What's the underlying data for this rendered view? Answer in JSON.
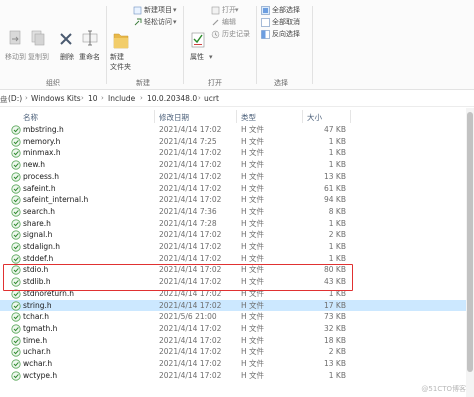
{
  "ribbon": {
    "move_to": "移动到",
    "copy_to": "复制到",
    "delete": "删除",
    "rename": "重命名",
    "organize": "组织",
    "new_item": "新建项目",
    "easy_access": "轻松访问",
    "new_folder_line1": "新建",
    "new_folder_line2": "文件夹",
    "new_group": "新建",
    "properties": "属性",
    "open": "打开",
    "edit": "编辑",
    "history": "历史记录",
    "open_group": "打开",
    "select_all": "全部选择",
    "select_none": "全部取消",
    "invert_selection": "反向选择",
    "select_group": "选择"
  },
  "address": {
    "crumbs": [
      "(D:)",
      "Windows Kits",
      "10",
      "Include",
      "10.0.20348.0",
      "ucrt"
    ],
    "lead_char": "盘"
  },
  "columns": {
    "name": "名称",
    "date": "修改日期",
    "type": "类型",
    "size": "大小"
  },
  "files": [
    {
      "name": "mbstring.h",
      "date": "2021/4/14 17:02",
      "type": "H 文件",
      "size": "47 KB"
    },
    {
      "name": "memory.h",
      "date": "2021/4/14 7:25",
      "type": "H 文件",
      "size": "1 KB"
    },
    {
      "name": "minmax.h",
      "date": "2021/4/14 17:02",
      "type": "H 文件",
      "size": "1 KB"
    },
    {
      "name": "new.h",
      "date": "2021/4/14 17:02",
      "type": "H 文件",
      "size": "1 KB"
    },
    {
      "name": "process.h",
      "date": "2021/4/14 17:02",
      "type": "H 文件",
      "size": "13 KB"
    },
    {
      "name": "safeint.h",
      "date": "2021/4/14 17:02",
      "type": "H 文件",
      "size": "61 KB"
    },
    {
      "name": "safeint_internal.h",
      "date": "2021/4/14 17:02",
      "type": "H 文件",
      "size": "94 KB"
    },
    {
      "name": "search.h",
      "date": "2021/4/14 7:36",
      "type": "H 文件",
      "size": "8 KB"
    },
    {
      "name": "share.h",
      "date": "2021/4/14 7:28",
      "type": "H 文件",
      "size": "1 KB"
    },
    {
      "name": "signal.h",
      "date": "2021/4/14 17:02",
      "type": "H 文件",
      "size": "2 KB"
    },
    {
      "name": "stdalign.h",
      "date": "2021/4/14 17:02",
      "type": "H 文件",
      "size": "1 KB"
    },
    {
      "name": "stddef.h",
      "date": "2021/4/14 17:02",
      "type": "H 文件",
      "size": "1 KB"
    },
    {
      "name": "stdio.h",
      "date": "2021/4/14 17:02",
      "type": "H 文件",
      "size": "80 KB"
    },
    {
      "name": "stdlib.h",
      "date": "2021/4/14 17:02",
      "type": "H 文件",
      "size": "43 KB"
    },
    {
      "name": "stdnoreturn.h",
      "date": "2021/4/14 17:02",
      "type": "H 文件",
      "size": "1 KB"
    },
    {
      "name": "string.h",
      "date": "2021/4/14 17:02",
      "type": "H 文件",
      "size": "17 KB"
    },
    {
      "name": "tchar.h",
      "date": "2021/5/6 21:00",
      "type": "H 文件",
      "size": "73 KB"
    },
    {
      "name": "tgmath.h",
      "date": "2021/4/14 17:02",
      "type": "H 文件",
      "size": "32 KB"
    },
    {
      "name": "time.h",
      "date": "2021/4/14 17:02",
      "type": "H 文件",
      "size": "18 KB"
    },
    {
      "name": "uchar.h",
      "date": "2021/4/14 17:02",
      "type": "H 文件",
      "size": "2 KB"
    },
    {
      "name": "wchar.h",
      "date": "2021/4/14 17:02",
      "type": "H 文件",
      "size": "13 KB"
    },
    {
      "name": "wctype.h",
      "date": "2021/4/14 17:02",
      "type": "H 文件",
      "size": "1 KB"
    }
  ],
  "selected_index": 15,
  "highlighted_names": [
    "stdio.h",
    "stdlib.h"
  ],
  "watermark": "@51CTO博客",
  "colors": {
    "selection": "#cce8ff",
    "highlight_box": "#e03131",
    "folder": "#e8b84a",
    "check": "#3a9a3a"
  }
}
